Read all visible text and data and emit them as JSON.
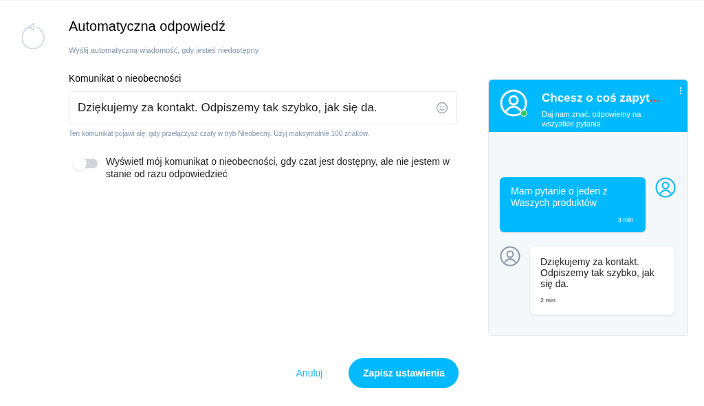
{
  "header": {
    "title": "Automatyczna odpowiedź",
    "subtitle": "Wyślij automatyczną wiadomość, gdy jesteś niedostępny"
  },
  "away_message": {
    "label": "Komunikat o nieobecności",
    "value": "Dziękujemy za kontakt. Odpiszemy tak szybko, jak się da.",
    "hint": "Ten komunikat pojawi się, gdy przełączysz czaty w tryb Nieobecny. Użyj maksymalnie 100 znaków."
  },
  "toggle": {
    "label": "Wyświetl mój komunikat o nieobecności, gdy czat jest dostępny, ale nie jestem w stanie od razu odpowiedzieć",
    "on": false
  },
  "preview": {
    "title": "Chcesz o coś zapyt",
    "title_ellipsis": "...",
    "subtitle": "Daj nam znać, odpowiemy na wszystkie pytania",
    "online": true,
    "messages": [
      {
        "kind": "visitor",
        "text": "Mam pytanie o jeden z Waszych produktów",
        "time": "3 min"
      },
      {
        "kind": "agent",
        "text": "Dziękujemy za kontakt. Odpiszemy tak szybko, jak się da.",
        "time": "2 min"
      }
    ]
  },
  "buttons": {
    "cancel": "Anuluj",
    "save": "Zapisz ustawienia"
  }
}
